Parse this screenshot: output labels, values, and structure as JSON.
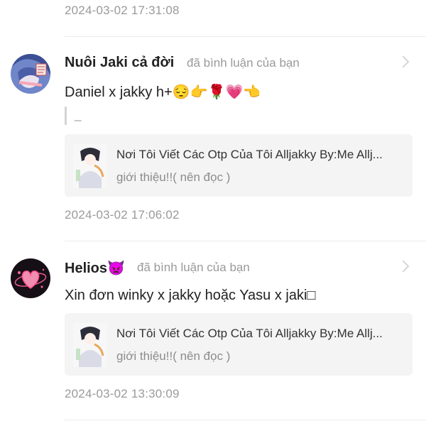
{
  "notifications": [
    {
      "timestamp_before": "2024-03-02 17:31:08"
    },
    {
      "user": "Nuôi Jaki cả đời",
      "action": "đã bình luận của bạn",
      "comment": "Daniel x jakky h+😔👉🌹💗👈",
      "quote": "_",
      "story": {
        "title": "Nơi Tôi Viết Các Otp Của Tôi Alljakky By:Me Allj...",
        "chapter": "giới thiệu!!( nên đọc )"
      },
      "timestamp": "2024-03-02 17:06:02"
    },
    {
      "user": "Helios👿",
      "action": "đã bình luận của bạn",
      "comment": "Xin đơn winky x jakky hoặc Yasu x jaki□",
      "story": {
        "title": "Nơi Tôi Viết Các Otp Của Tôi Alljakky By:Me Allj...",
        "chapter": "giới thiệu!!( nên đọc )"
      },
      "timestamp": "2024-03-02 13:30:09"
    }
  ],
  "colors": {
    "text_primary": "#222222",
    "text_muted": "#9a9a9a",
    "card_bg": "#f4f4f4"
  }
}
